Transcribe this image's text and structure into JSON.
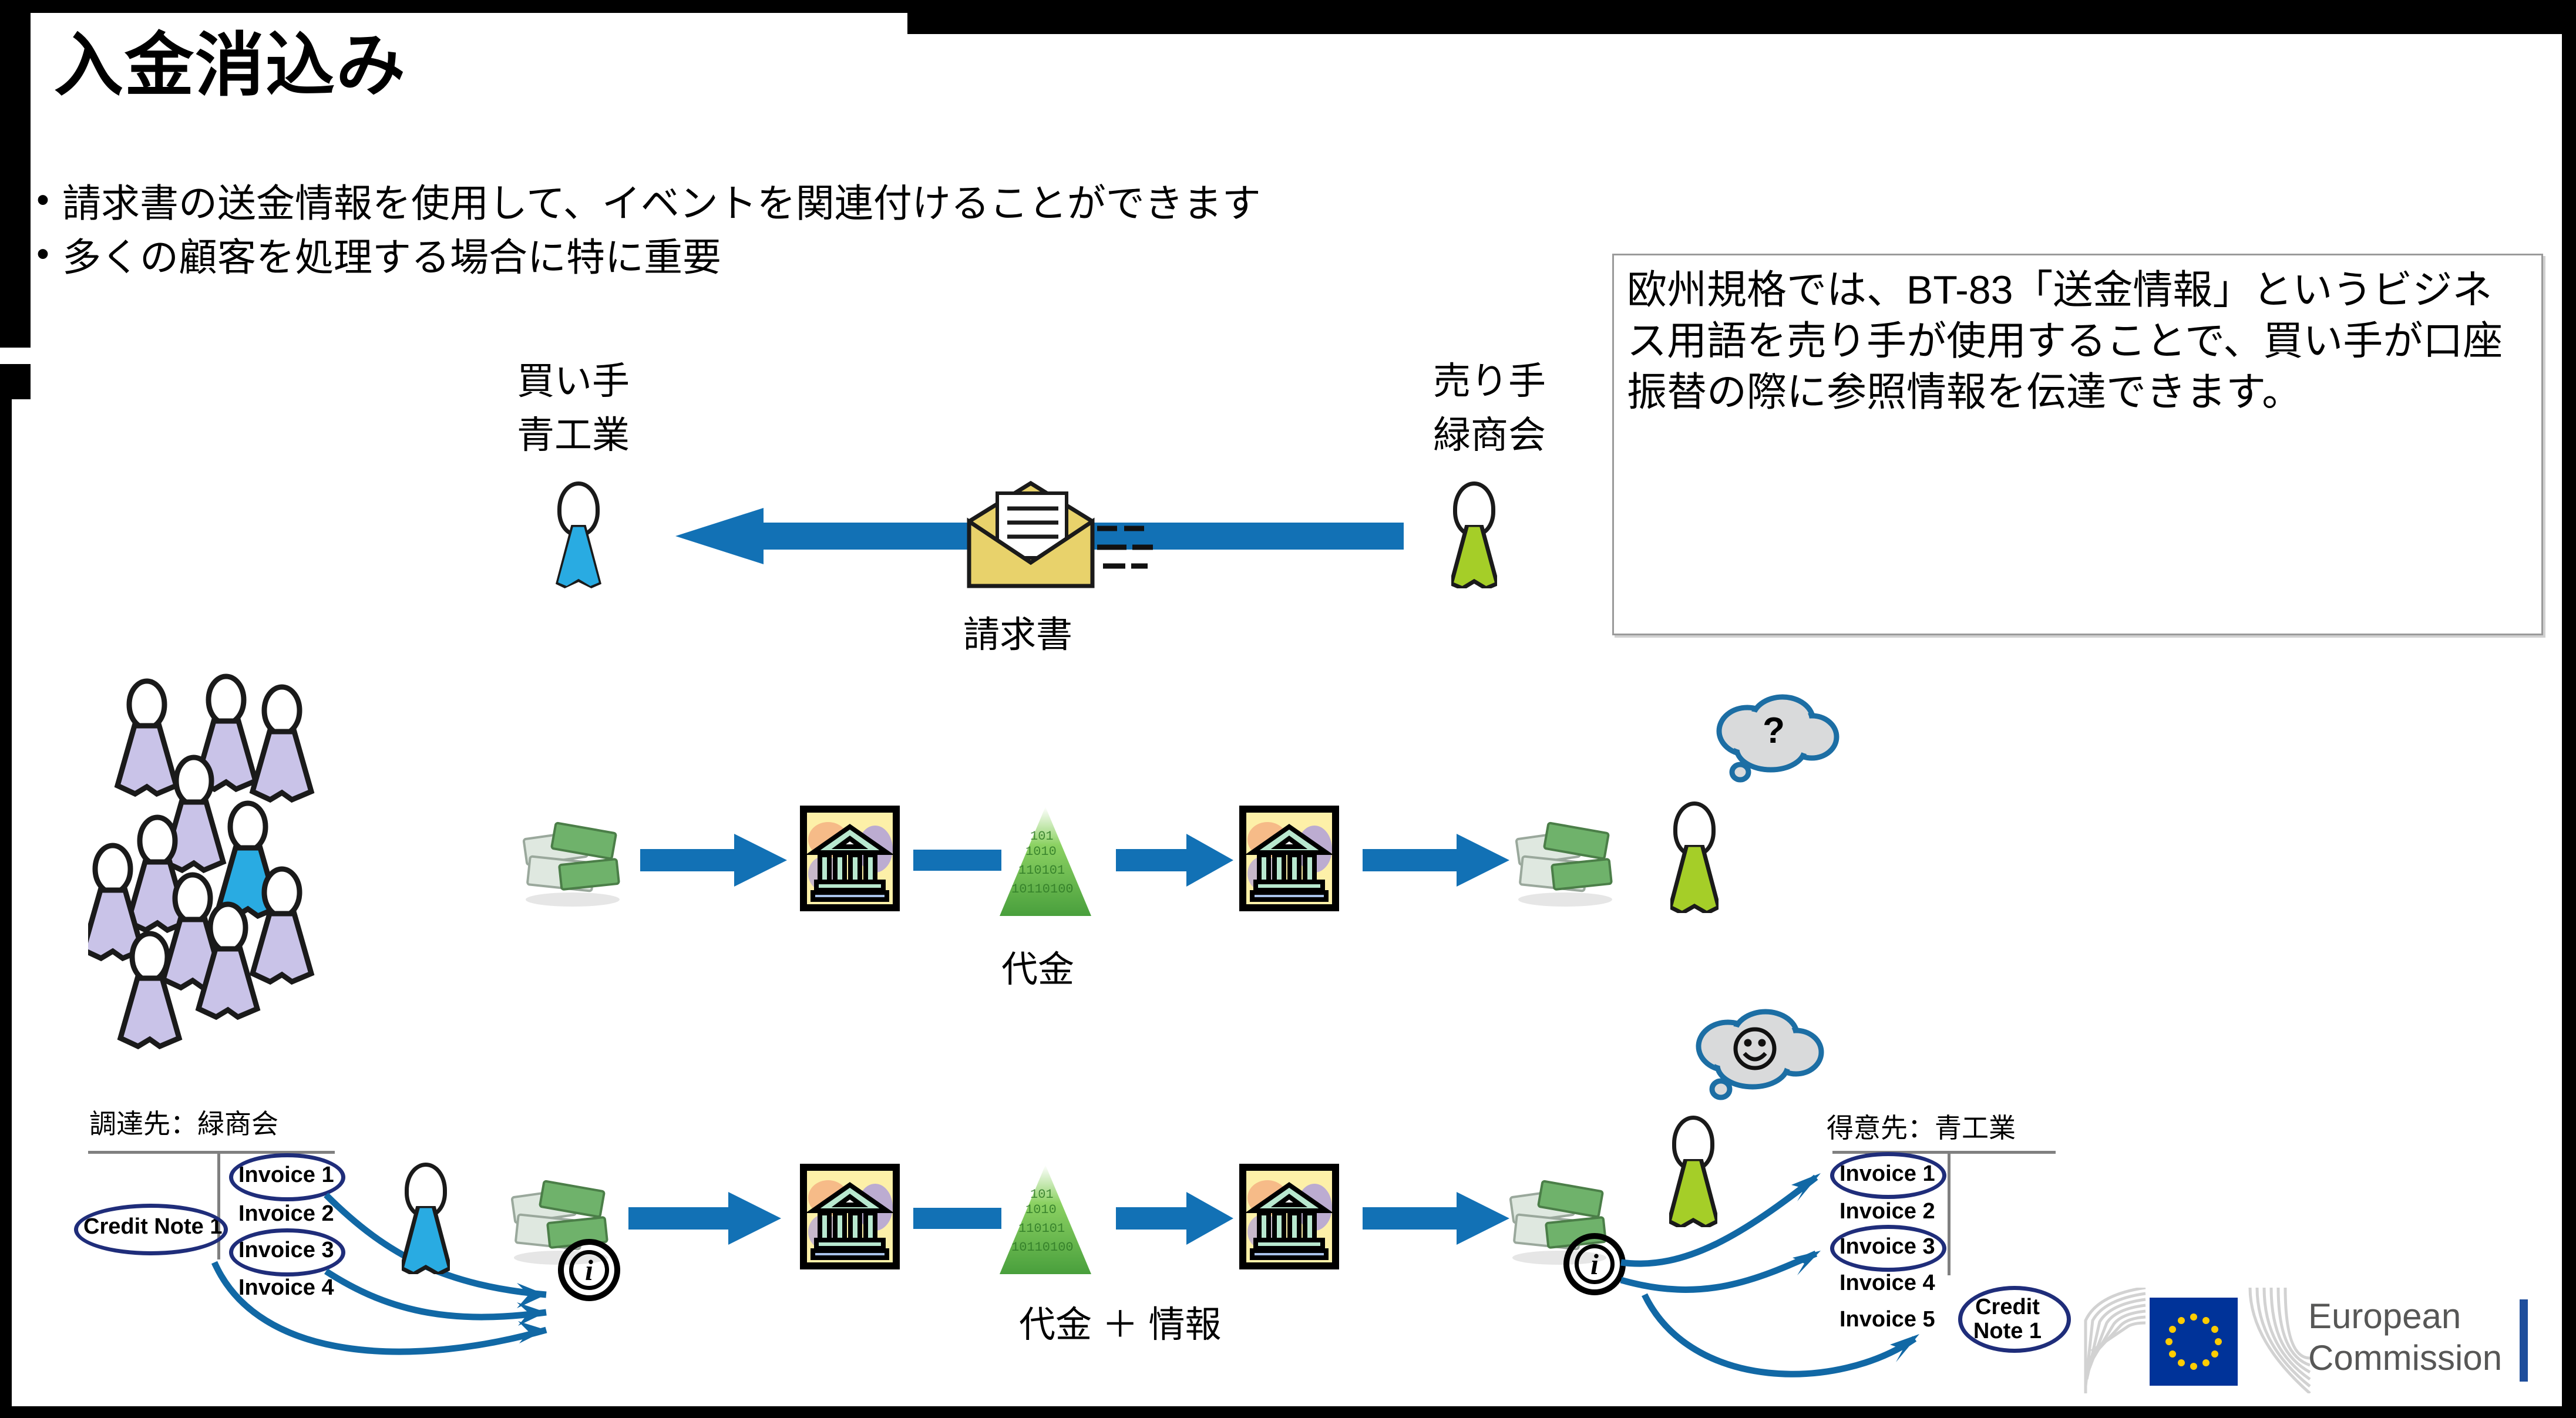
{
  "slide": {
    "title": "入金消込み",
    "bullets": [
      "請求書の送金情報を使用して、イベントを関連付けることができます",
      "多くの顧客を処理する場合に特に重要"
    ],
    "callout": "欧州規格では、BT-83「送金情報」というビジネス用語を売り手が使用することで、買い手が口座振替の際に参照情報を伝達できます。"
  },
  "row_invoice": {
    "buyer_role": "買い手",
    "buyer_name": "青工業",
    "seller_role": "売り手",
    "seller_name": "緑商会",
    "flow_label": "請求書",
    "envelope_icon": "envelope-icon",
    "arrow_icon": "arrow-left-icon"
  },
  "row_payment": {
    "flow_label": "代金",
    "bank_icon": "bank-icon",
    "money_icon": "money-icon",
    "data_icon": "binary-data-icon",
    "bubble_text": "?",
    "bubble_icon": "thought-bubble-question-icon"
  },
  "row_payment_info": {
    "flow_label": "代金 ＋ 情報",
    "bubble_text": "☺",
    "bubble_icon": "thought-bubble-smiley-icon",
    "info_icon": "info-circle-icon",
    "supplier_ledger": {
      "caption": "調達先：緑商会",
      "credit_notes": [
        "Credit Note 1"
      ],
      "invoices": [
        "Invoice 1",
        "Invoice 2",
        "Invoice 3",
        "Invoice 4"
      ],
      "highlighted": [
        "Credit Note 1",
        "Invoice 1",
        "Invoice 3"
      ]
    },
    "customer_ledger": {
      "caption": "得意先：青工業",
      "invoices": [
        "Invoice 1",
        "Invoice 2",
        "Invoice 3",
        "Invoice 4",
        "Invoice 5"
      ],
      "credit_notes": [
        "Credit Note 1"
      ],
      "highlighted": [
        "Invoice 1",
        "Invoice 3",
        "Credit Note 1"
      ]
    }
  },
  "footer": {
    "logo_line1": "European",
    "logo_line2": "Commission",
    "logo_icon": "eu-flag-icon"
  },
  "colors": {
    "arrow_blue": "#1271b5",
    "buyer_blue": "#29ABE2",
    "seller_green": "#A5CE28",
    "crowd_lavender": "#C9C3E8",
    "circle_navy": "#1f2d7a",
    "bubble_grey": "#d9dadb",
    "bubble_outline": "#1c6ea4",
    "eu_blue": "#003399",
    "eu_star_yellow": "#FFCC00"
  }
}
